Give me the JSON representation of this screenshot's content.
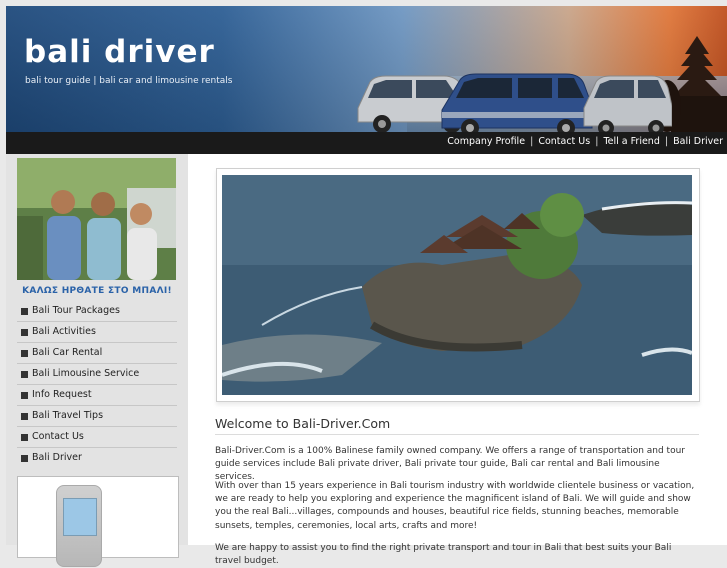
{
  "header": {
    "site_title": "bali driver",
    "tagline": "bali tour guide | bali car and limousine rentals"
  },
  "topnav": {
    "links": [
      "Company Profile",
      "Contact Us",
      "Tell a Friend",
      "Bali Driver"
    ],
    "separator": "|"
  },
  "sidebar": {
    "welcome_text": "ΚΑΛΩΣ ΗΡΘΑΤΕ ΣΤΟ ΜΠΑΛΙ!",
    "menu": [
      {
        "label": "Bali Tour Packages"
      },
      {
        "label": "Bali Activities"
      },
      {
        "label": "Bali Car Rental"
      },
      {
        "label": "Bali Limousine Service"
      },
      {
        "label": "Info Request"
      },
      {
        "label": "Bali Travel Tips"
      },
      {
        "label": "Contact Us"
      },
      {
        "label": "Bali Driver"
      }
    ]
  },
  "main": {
    "heading": "Welcome to Bali-Driver.Com",
    "paragraphs": [
      "Bali-Driver.Com is a 100% Balinese family owned company. We offers a range of transportation and tour guide services include Bali private driver, Bali private tour guide, Bali car rental and Bali limousine services.",
      "With over than 15 years experience in Bali tourism industry with worldwide clientele business or vacation, we are ready to help you exploring and experience the magnificent island of Bali. We will guide and show you the real Bali...villages, compounds and houses, beautiful rice fields, stunning beaches, memorable sunsets, temples, ceremonies, local arts, crafts and more!",
      "We are happy to assist you to find the right private transport and tour in Bali that best suits your Bali travel budget."
    ]
  },
  "colors": {
    "nav_background": "#1a1a1a",
    "sidebar_background": "#e3e3e3",
    "welcome_text": "#2a62a8"
  }
}
